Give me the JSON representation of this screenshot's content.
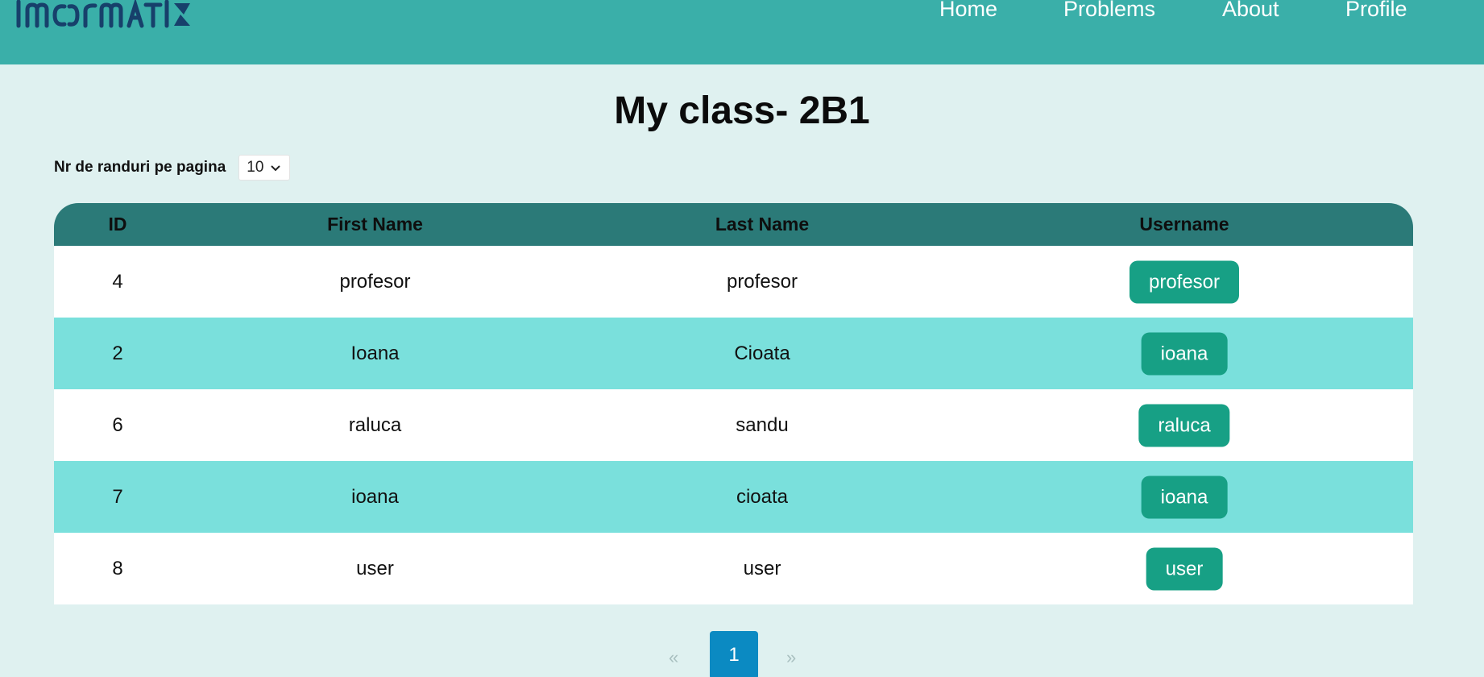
{
  "header": {
    "logo_text": "INFORMATIX",
    "nav": {
      "home": "Home",
      "problems": "Problems",
      "about": "About",
      "profile": "Profile"
    }
  },
  "page": {
    "title": "My class- 2B1"
  },
  "rows_per_page": {
    "label": "Nr de randuri pe pagina",
    "value": "10"
  },
  "table": {
    "headers": {
      "id": "ID",
      "first_name": "First Name",
      "last_name": "Last Name",
      "username": "Username"
    },
    "rows": [
      {
        "id": "4",
        "first_name": "profesor",
        "last_name": "profesor",
        "username": "profesor"
      },
      {
        "id": "2",
        "first_name": "Ioana",
        "last_name": "Cioata",
        "username": "ioana"
      },
      {
        "id": "6",
        "first_name": "raluca",
        "last_name": "sandu",
        "username": "raluca"
      },
      {
        "id": "7",
        "first_name": "ioana",
        "last_name": "cioata",
        "username": "ioana"
      },
      {
        "id": "8",
        "first_name": "user",
        "last_name": "user",
        "username": "user"
      }
    ]
  },
  "pagination": {
    "prev": "«",
    "current": "1",
    "next": "»"
  },
  "colors": {
    "header_bg": "#3aafa9",
    "page_bg": "#dff1f0",
    "table_head_bg": "#2b7a78",
    "row_alt_bg": "#7ae0dc",
    "username_button_bg": "#17a085",
    "page_active_bg": "#0b8ac2"
  }
}
